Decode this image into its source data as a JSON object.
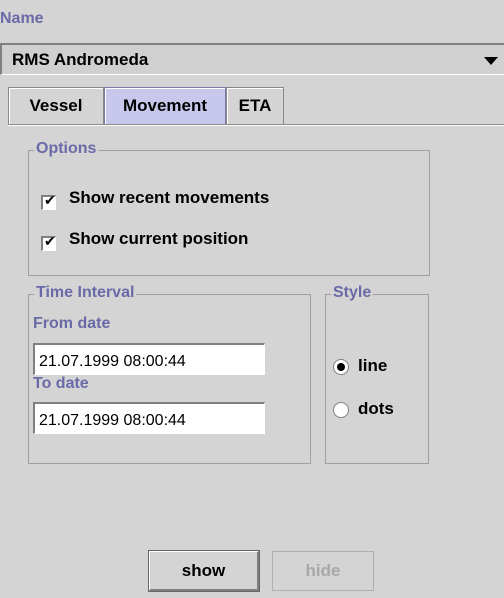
{
  "name": {
    "label": "Name",
    "value": "RMS Andromeda"
  },
  "tabs": [
    {
      "label": "Vessel",
      "selected": false
    },
    {
      "label": "Movement",
      "selected": true
    },
    {
      "label": "ETA",
      "selected": false
    }
  ],
  "options": {
    "title": "Options",
    "show_recent_movements": {
      "label": "Show recent movements",
      "checked": true
    },
    "show_current_position": {
      "label": "Show current position",
      "checked": true
    }
  },
  "time_interval": {
    "title": "Time Interval",
    "from_label": "From date",
    "from_value": "21.07.1999 08:00:44",
    "to_label": "To date",
    "to_value": "21.07.1999 08:00:44"
  },
  "style": {
    "title": "Style",
    "options": [
      {
        "label": "line",
        "selected": true
      },
      {
        "label": "dots",
        "selected": false
      }
    ]
  },
  "buttons": {
    "show_label": "show",
    "hide_label": "hide",
    "hide_enabled": false
  },
  "colors": {
    "accent_text": "#6a6aa8",
    "selected_tab": "#c8c8ec",
    "background": "#d4d4d4"
  }
}
